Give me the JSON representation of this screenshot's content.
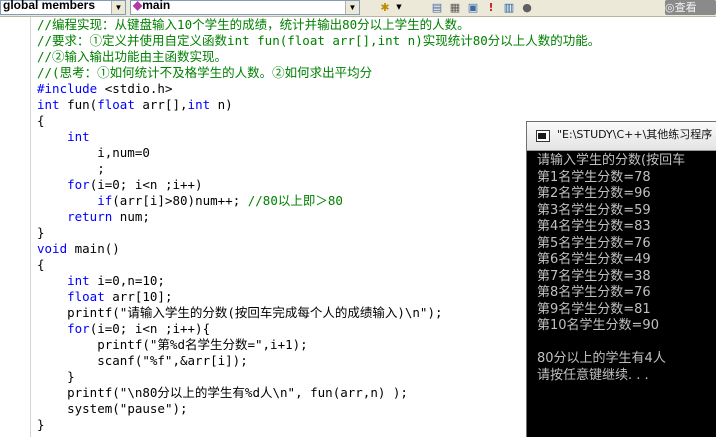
{
  "toolbar": {
    "scope_combo": "global members",
    "function_combo": "main",
    "watch_button": "查看"
  },
  "editor": {
    "lines": [
      [
        {
          "c": "cm",
          "t": "//编程实现：从键盘输入10个学生的成绩，统计并输出80分以上学生的人数。"
        }
      ],
      [
        {
          "c": "cm",
          "t": "//要求：①定义并使用自定义函数int fun(float arr[],int n)实现统计80分以上人数的功能。"
        }
      ],
      [
        {
          "c": "cm",
          "t": "//②输入输出功能由主函数实现。"
        }
      ],
      [
        {
          "c": "cm",
          "t": "//(思考：①如何统计不及格学生的人数。②如何求出平均分"
        }
      ],
      [
        {
          "c": "kw",
          "t": "#include"
        },
        {
          "c": "pp",
          "t": " <stdio.h>"
        }
      ],
      [
        {
          "c": "kw",
          "t": "int"
        },
        {
          "c": "",
          "t": " fun("
        },
        {
          "c": "kw",
          "t": "float"
        },
        {
          "c": "",
          "t": " arr[],"
        },
        {
          "c": "kw",
          "t": "int"
        },
        {
          "c": "",
          "t": " n)"
        }
      ],
      [
        {
          "c": "",
          "t": "{"
        }
      ],
      [
        {
          "c": "",
          "t": "    "
        },
        {
          "c": "kw",
          "t": "int"
        }
      ],
      [
        {
          "c": "",
          "t": "        i,num=0"
        }
      ],
      [
        {
          "c": "",
          "t": "        ;"
        }
      ],
      [
        {
          "c": "",
          "t": "    "
        },
        {
          "c": "kw",
          "t": "for"
        },
        {
          "c": "",
          "t": "(i=0; i<n ;i++)"
        }
      ],
      [
        {
          "c": "",
          "t": "        "
        },
        {
          "c": "kw",
          "t": "if"
        },
        {
          "c": "",
          "t": "(arr[i]>80)num++; "
        },
        {
          "c": "cm",
          "t": "//80以上即＞80"
        }
      ],
      [
        {
          "c": "",
          "t": "    "
        },
        {
          "c": "kw",
          "t": "return"
        },
        {
          "c": "",
          "t": " num;"
        }
      ],
      [
        {
          "c": "",
          "t": "}"
        }
      ],
      [
        {
          "c": "kw",
          "t": "void"
        },
        {
          "c": "",
          "t": " main()"
        }
      ],
      [
        {
          "c": "",
          "t": "{"
        }
      ],
      [
        {
          "c": "",
          "t": "    "
        },
        {
          "c": "kw",
          "t": "int"
        },
        {
          "c": "",
          "t": " i=0,n=10;"
        }
      ],
      [
        {
          "c": "",
          "t": "    "
        },
        {
          "c": "kw",
          "t": "float"
        },
        {
          "c": "",
          "t": " arr[10];"
        }
      ],
      [
        {
          "c": "",
          "t": "    printf("
        },
        {
          "c": "st",
          "t": "\"请输入学生的分数(按回车完成每个人的成绩输入)\\n\""
        },
        {
          "c": "",
          "t": ");"
        }
      ],
      [
        {
          "c": "",
          "t": "    "
        },
        {
          "c": "kw",
          "t": "for"
        },
        {
          "c": "",
          "t": "(i=0; i<n ;i++){"
        }
      ],
      [
        {
          "c": "",
          "t": "        printf("
        },
        {
          "c": "st",
          "t": "\"第%d名学生分数=\""
        },
        {
          "c": "",
          "t": ",i+1);"
        }
      ],
      [
        {
          "c": "",
          "t": "        scanf("
        },
        {
          "c": "st",
          "t": "\"%f\""
        },
        {
          "c": "",
          "t": ",&arr[i]);"
        }
      ],
      [
        {
          "c": "",
          "t": "    }"
        }
      ],
      [
        {
          "c": "",
          "t": "    printf("
        },
        {
          "c": "st",
          "t": "\"\\n80分以上的学生有%d人\\n\""
        },
        {
          "c": "",
          "t": ", fun(arr,n) );"
        }
      ],
      [
        {
          "c": "",
          "t": "    system("
        },
        {
          "c": "st",
          "t": "\"pause\""
        },
        {
          "c": "",
          "t": ");"
        }
      ],
      [
        {
          "c": "",
          "t": "}"
        }
      ]
    ]
  },
  "console": {
    "title": "\"E:\\STUDY\\C++\\其他练习程序",
    "output": [
      "请输入学生的分数(按回车",
      "第1名学生分数=78",
      "第2名学生分数=96",
      "第3名学生分数=59",
      "第4名学生分数=83",
      "第5名学生分数=76",
      "第6名学生分数=49",
      "第7名学生分数=38",
      "第8名学生分数=76",
      "第9名学生分数=81",
      "第10名学生分数=90",
      "",
      "80分以上的学生有4人",
      "请按任意键继续. . ."
    ]
  }
}
